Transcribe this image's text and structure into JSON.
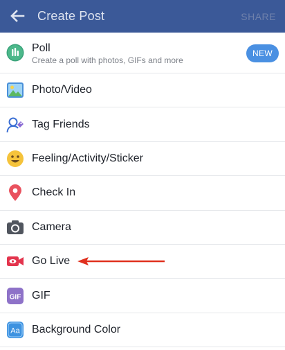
{
  "header": {
    "title": "Create Post",
    "share_label": "SHARE",
    "background": "#3b5998"
  },
  "options": [
    {
      "label": "Poll",
      "subtitle": "Create a poll with photos, GIFs and more",
      "badge": "NEW",
      "icon": "poll-icon"
    },
    {
      "label": "Photo/Video",
      "icon": "photo-video-icon"
    },
    {
      "label": "Tag Friends",
      "icon": "tag-friends-icon"
    },
    {
      "label": "Feeling/Activity/Sticker",
      "icon": "feeling-icon"
    },
    {
      "label": "Check In",
      "icon": "location-pin-icon"
    },
    {
      "label": "Camera",
      "icon": "camera-icon"
    },
    {
      "label": "Go Live",
      "icon": "live-video-icon"
    },
    {
      "label": "GIF",
      "icon": "gif-icon"
    },
    {
      "label": "Background Color",
      "icon": "background-color-icon"
    }
  ],
  "colors": {
    "accent": "#4a90e2",
    "annotation_arrow": "#e0301e"
  }
}
